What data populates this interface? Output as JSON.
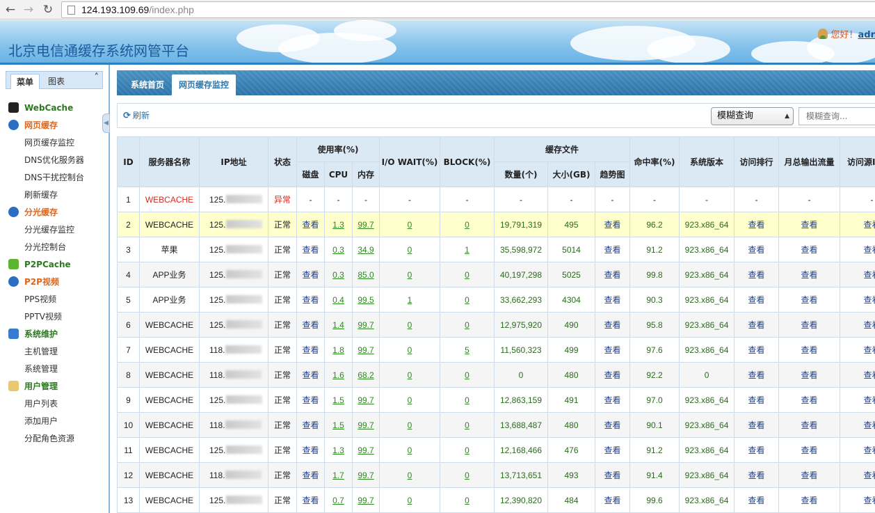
{
  "browser": {
    "url_host": "124.193.109.69",
    "url_path": "/index.php"
  },
  "header": {
    "title": "北京电信通缓存系统网管平台",
    "greeting": "您好！",
    "user": "adr"
  },
  "sidebar": {
    "tabs": [
      "菜单",
      "图表"
    ],
    "groups": [
      {
        "label": "WebCache",
        "icon": "webcache-icon",
        "color": "green",
        "items": []
      },
      {
        "label": "网页缓存",
        "icon": "globe-icon",
        "color": "orange",
        "items": [
          "网页缓存监控",
          "DNS优化服务器",
          "DNS干扰控制台",
          "刷新缓存"
        ]
      },
      {
        "label": "分光缓存",
        "icon": "globe-icon",
        "color": "orange",
        "items": [
          "分光缓存监控",
          "分光控制台"
        ]
      },
      {
        "label": "P2PCache",
        "icon": "check-icon",
        "color": "green",
        "items": []
      },
      {
        "label": "P2P视频",
        "icon": "globe-icon",
        "color": "orange",
        "items": [
          "PPS视频",
          "PPTV视频"
        ]
      },
      {
        "label": "系统维护",
        "icon": "monitor-icon",
        "color": "green",
        "items": [
          "主机管理",
          "系统管理"
        ]
      },
      {
        "label": "用户管理",
        "icon": "folder-icon",
        "color": "green",
        "items": [
          "用户列表",
          "添加用户",
          "分配角色资源"
        ]
      }
    ]
  },
  "main": {
    "tabs": [
      "系统首页",
      "网页缓存监控"
    ],
    "toolbar": {
      "refresh": "刷新",
      "select_value": "模糊查询",
      "search_placeholder": "模糊查询..."
    },
    "table": {
      "headers": {
        "id": "ID",
        "name": "服务器名称",
        "ip": "IP地址",
        "status": "状态",
        "usage": "使用率(%)",
        "disk": "磁盘",
        "cpu": "CPU",
        "mem": "内存",
        "iowait": "I/O WAIT(%)",
        "block": "BLOCK(%)",
        "cache": "缓存文件",
        "count": "数量(个)",
        "size": "大小(GB)",
        "trend": "趋势图",
        "hit": "命中率(%)",
        "version": "系统版本",
        "rank": "访问排行",
        "traffic": "月总输出流量",
        "source": "访问源IP"
      },
      "rows": [
        {
          "id": "1",
          "name": "WEBCACHE",
          "ip": "125.",
          "status": "异常",
          "disk": "-",
          "cpu": "-",
          "mem": "-",
          "iowait": "-",
          "block": "-",
          "count": "-",
          "size": "-",
          "trend": "-",
          "hit": "-",
          "version": "-",
          "rank": "-",
          "traffic": "-",
          "source": "-"
        },
        {
          "id": "2",
          "name": "WEBCACHE",
          "ip": "125.",
          "status": "正常",
          "disk": "查看",
          "cpu": "1.3",
          "mem": "99.7",
          "iowait": "0",
          "block": "0",
          "count": "19,791,319",
          "size": "495",
          "trend": "查看",
          "hit": "96.2",
          "version": "923.x86_64",
          "rank": "查看",
          "traffic": "查看",
          "source": "查看"
        },
        {
          "id": "3",
          "name": "苹果",
          "ip": "125.",
          "status": "正常",
          "disk": "查看",
          "cpu": "0.3",
          "mem": "34.9",
          "iowait": "0",
          "block": "1",
          "count": "35,598,972",
          "size": "5014",
          "trend": "查看",
          "hit": "91.2",
          "version": "923.x86_64",
          "rank": "查看",
          "traffic": "查看",
          "source": "查看"
        },
        {
          "id": "4",
          "name": "APP业务",
          "ip": "125.",
          "status": "正常",
          "disk": "查看",
          "cpu": "0.3",
          "mem": "85.0",
          "iowait": "0",
          "block": "0",
          "count": "40,197,298",
          "size": "5025",
          "trend": "查看",
          "hit": "99.8",
          "version": "923.x86_64",
          "rank": "查看",
          "traffic": "查看",
          "source": "查看"
        },
        {
          "id": "5",
          "name": "APP业务",
          "ip": "125.",
          "status": "正常",
          "disk": "查看",
          "cpu": "0.4",
          "mem": "99.5",
          "iowait": "1",
          "block": "0",
          "count": "33,662,293",
          "size": "4304",
          "trend": "查看",
          "hit": "90.3",
          "version": "923.x86_64",
          "rank": "查看",
          "traffic": "查看",
          "source": "查看"
        },
        {
          "id": "6",
          "name": "WEBCACHE",
          "ip": "125.",
          "status": "正常",
          "disk": "查看",
          "cpu": "1.4",
          "mem": "99.7",
          "iowait": "0",
          "block": "0",
          "count": "12,975,920",
          "size": "490",
          "trend": "查看",
          "hit": "95.8",
          "version": "923.x86_64",
          "rank": "查看",
          "traffic": "查看",
          "source": "查看"
        },
        {
          "id": "7",
          "name": "WEBCACHE",
          "ip": "118.",
          "status": "正常",
          "disk": "查看",
          "cpu": "1.8",
          "mem": "99.7",
          "iowait": "0",
          "block": "5",
          "count": "11,560,323",
          "size": "499",
          "trend": "查看",
          "hit": "97.6",
          "version": "923.x86_64",
          "rank": "查看",
          "traffic": "查看",
          "source": "查看"
        },
        {
          "id": "8",
          "name": "WEBCACHE",
          "ip": "118.",
          "status": "正常",
          "disk": "查看",
          "cpu": "1.6",
          "mem": "68.2",
          "iowait": "0",
          "block": "0",
          "count": "0",
          "size": "480",
          "trend": "查看",
          "hit": "92.2",
          "version": "0",
          "rank": "查看",
          "traffic": "查看",
          "source": "查看"
        },
        {
          "id": "9",
          "name": "WEBCACHE",
          "ip": "125.",
          "status": "正常",
          "disk": "查看",
          "cpu": "1.5",
          "mem": "99.7",
          "iowait": "0",
          "block": "0",
          "count": "12,863,159",
          "size": "491",
          "trend": "查看",
          "hit": "97.0",
          "version": "923.x86_64",
          "rank": "查看",
          "traffic": "查看",
          "source": "查看"
        },
        {
          "id": "10",
          "name": "WEBCACHE",
          "ip": "118.",
          "status": "正常",
          "disk": "查看",
          "cpu": "1.5",
          "mem": "99.7",
          "iowait": "0",
          "block": "0",
          "count": "13,688,487",
          "size": "480",
          "trend": "查看",
          "hit": "90.1",
          "version": "923.x86_64",
          "rank": "查看",
          "traffic": "查看",
          "source": "查看"
        },
        {
          "id": "11",
          "name": "WEBCACHE",
          "ip": "125.",
          "status": "正常",
          "disk": "查看",
          "cpu": "1.3",
          "mem": "99.7",
          "iowait": "0",
          "block": "0",
          "count": "12,168,466",
          "size": "476",
          "trend": "查看",
          "hit": "91.2",
          "version": "923.x86_64",
          "rank": "查看",
          "traffic": "查看",
          "source": "查看"
        },
        {
          "id": "12",
          "name": "WEBCACHE",
          "ip": "118.",
          "status": "正常",
          "disk": "查看",
          "cpu": "1.7",
          "mem": "99.7",
          "iowait": "0",
          "block": "0",
          "count": "13,713,651",
          "size": "493",
          "trend": "查看",
          "hit": "91.4",
          "version": "923.x86_64",
          "rank": "查看",
          "traffic": "查看",
          "source": "查看"
        },
        {
          "id": "13",
          "name": "WEBCACHE",
          "ip": "125.",
          "status": "正常",
          "disk": "查看",
          "cpu": "0.7",
          "mem": "99.7",
          "iowait": "0",
          "block": "0",
          "count": "12,390,820",
          "size": "484",
          "trend": "查看",
          "hit": "99.6",
          "version": "923.x86_64",
          "rank": "查看",
          "traffic": "查看",
          "source": "查看"
        }
      ]
    }
  }
}
